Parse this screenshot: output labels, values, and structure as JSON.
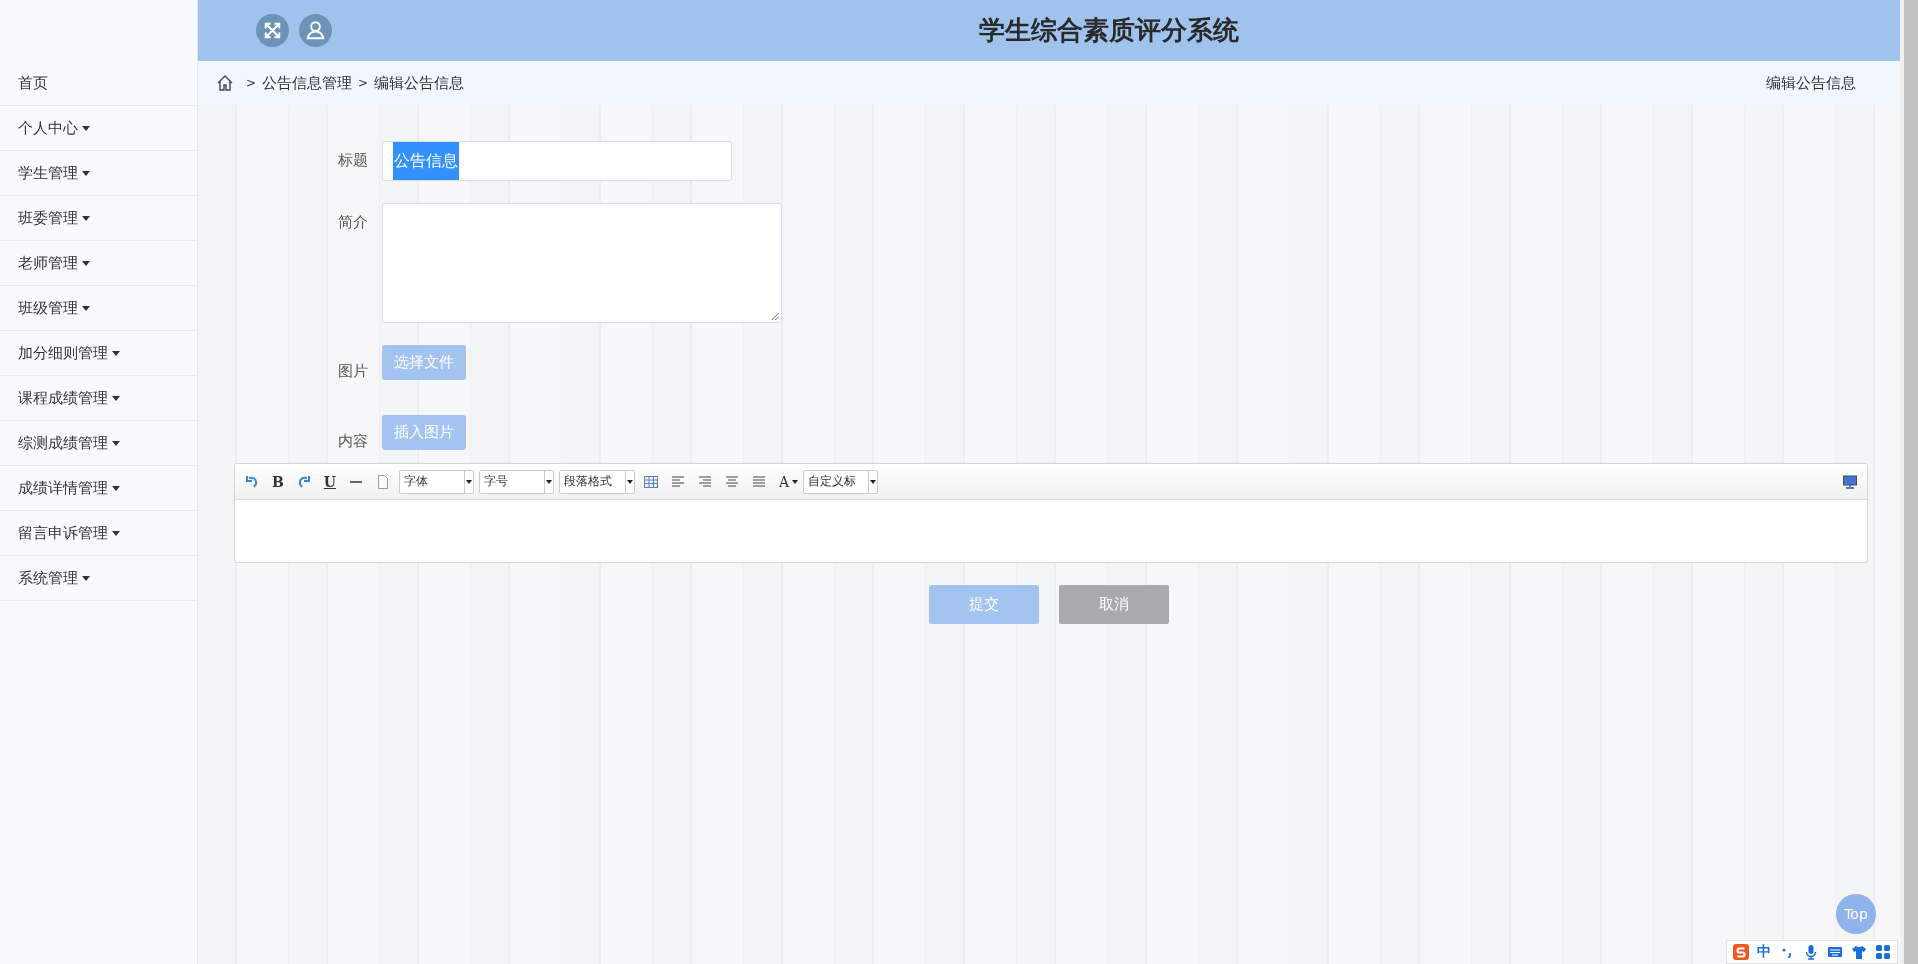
{
  "header": {
    "title": "学生综合素质评分系统"
  },
  "breadcrumb": {
    "separator": ">",
    "items": [
      "公告信息管理",
      "编辑公告信息"
    ],
    "page_title": "编辑公告信息"
  },
  "sidebar": {
    "items": [
      {
        "label": "首页",
        "has_caret": false
      },
      {
        "label": "个人中心",
        "has_caret": true
      },
      {
        "label": "学生管理",
        "has_caret": true
      },
      {
        "label": "班委管理",
        "has_caret": true
      },
      {
        "label": "老师管理",
        "has_caret": true
      },
      {
        "label": "班级管理",
        "has_caret": true
      },
      {
        "label": "加分细则管理",
        "has_caret": true
      },
      {
        "label": "课程成绩管理",
        "has_caret": true
      },
      {
        "label": "综测成绩管理",
        "has_caret": true
      },
      {
        "label": "成绩详情管理",
        "has_caret": true
      },
      {
        "label": "留言申诉管理",
        "has_caret": true
      },
      {
        "label": "系统管理",
        "has_caret": true
      }
    ]
  },
  "form": {
    "fields": [
      {
        "kind": "text",
        "label": "标题",
        "value": "公告信息",
        "text_selected": true
      },
      {
        "kind": "textarea",
        "label": "简介"
      },
      {
        "kind": "file",
        "label": "图片",
        "button": "选择文件"
      },
      {
        "kind": "editor",
        "label": "内容",
        "button": "插入图片"
      }
    ]
  },
  "editor": {
    "bold": "B",
    "underline": "U",
    "font_color": "A",
    "selects": [
      "字体",
      "字号",
      "段落格式",
      "自定义标"
    ]
  },
  "actions": [
    {
      "label": "提交",
      "kind": "primary"
    },
    {
      "label": "取消",
      "kind": "secondary"
    }
  ],
  "back_to_top": "Top",
  "ime": {
    "mode": "中"
  }
}
